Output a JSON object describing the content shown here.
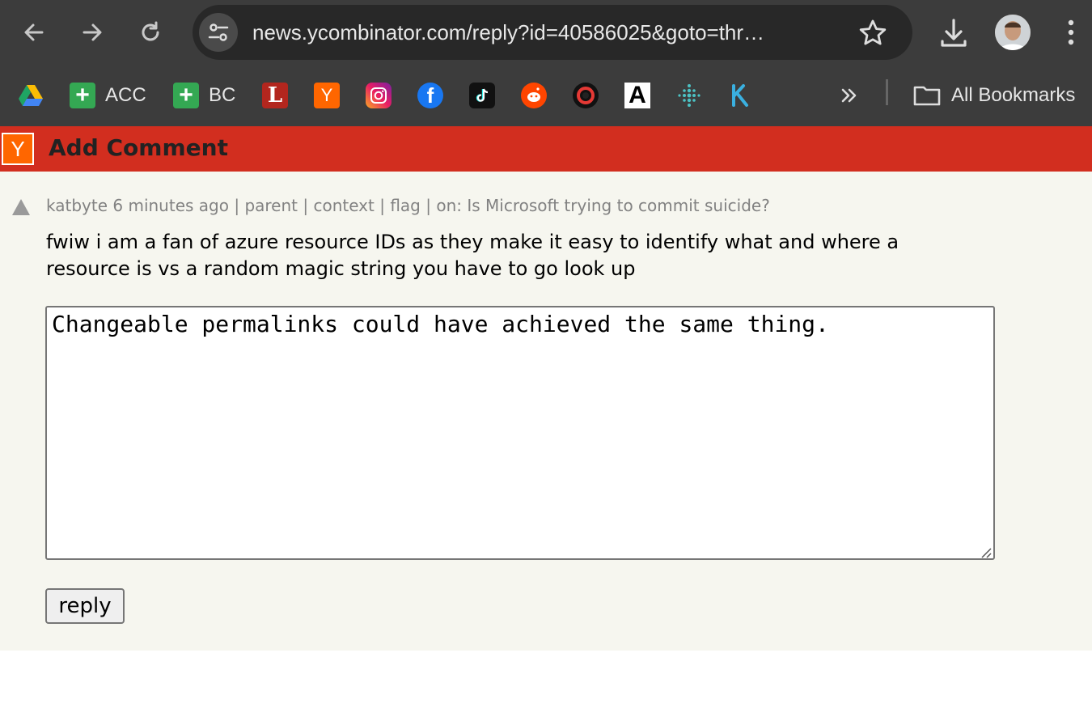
{
  "browser": {
    "url": "news.ycombinator.com/reply?id=40586025&goto=thr…",
    "bookmarks": [
      {
        "icon": "google-drive-icon",
        "label": ""
      },
      {
        "icon": "green-plus-icon",
        "label": "ACC"
      },
      {
        "icon": "green-plus-icon",
        "label": "BC"
      },
      {
        "icon": "l-logo-icon",
        "label": ""
      },
      {
        "icon": "y-combinator-icon",
        "label": ""
      },
      {
        "icon": "instagram-icon",
        "label": ""
      },
      {
        "icon": "facebook-icon",
        "label": ""
      },
      {
        "icon": "tiktok-icon",
        "label": ""
      },
      {
        "icon": "reddit-icon",
        "label": ""
      },
      {
        "icon": "ring-logo-icon",
        "label": ""
      },
      {
        "icon": "a-logo-icon",
        "label": ""
      },
      {
        "icon": "fitbit-icon",
        "label": ""
      },
      {
        "icon": "k-logo-icon",
        "label": ""
      }
    ],
    "all_bookmarks_label": "All Bookmarks"
  },
  "hn": {
    "logo": "Y",
    "page_title": "Add Comment",
    "comment": {
      "author": "katbyte",
      "age": "6 minutes ago",
      "sep": "|",
      "parent": "parent",
      "context": "context",
      "flag": "flag",
      "on_prefix": "on:",
      "story_title": "Is Microsoft trying to commit suicide?",
      "text": "fwiw i am a fan of azure resource IDs as they make it easy to identify what and where a resource is vs a random magic string you have to go look up"
    },
    "reply_text": "Changeable permalinks could have achieved the same thing.",
    "reply_button": "reply"
  },
  "colors": {
    "hn_header": "#d22e1f",
    "hn_logo": "#ff6600",
    "hn_bg": "#f6f6ef",
    "chrome_bg": "#3c3c3c"
  }
}
